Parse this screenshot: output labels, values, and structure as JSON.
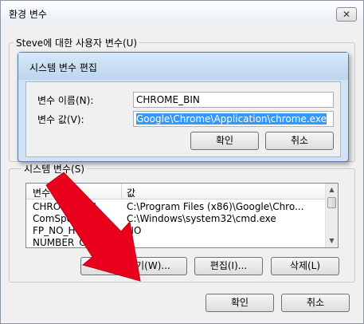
{
  "window": {
    "title": "환경 변수",
    "close_glyph": "✕"
  },
  "user_group": {
    "label": "Steve에 대한 사용자 변수(U)"
  },
  "system_group": {
    "label": "시스템 변수(S)",
    "columns": [
      "변수",
      "값"
    ],
    "rows": [
      {
        "name": "CHROME_BIN",
        "value": "C:\\Program Files (x86)\\Google\\Chro..."
      },
      {
        "name": "ComSpec",
        "value": "C:\\Windows\\system32\\cmd.exe"
      },
      {
        "name": "FP_NO_HOST_C",
        "value": "NO"
      },
      {
        "name": "NUMBER_OF_P",
        "value": "4"
      }
    ],
    "new_button": "새로 만들기(W)...",
    "edit_button": "편집(I)...",
    "delete_button": "삭제(L)"
  },
  "footer": {
    "ok_button": "확인",
    "cancel_button": "취소"
  },
  "dialog": {
    "title": "시스템 변수 편집",
    "name_label": "변수 이름(N):",
    "name_value": "CHROME_BIN",
    "value_label": "변수 값(V):",
    "value_value": "Google\\Chrome\\Application\\chrome.exe",
    "ok_button": "확인",
    "cancel_button": "취소"
  },
  "annotation": {
    "arrow_color": "#e8001c"
  }
}
